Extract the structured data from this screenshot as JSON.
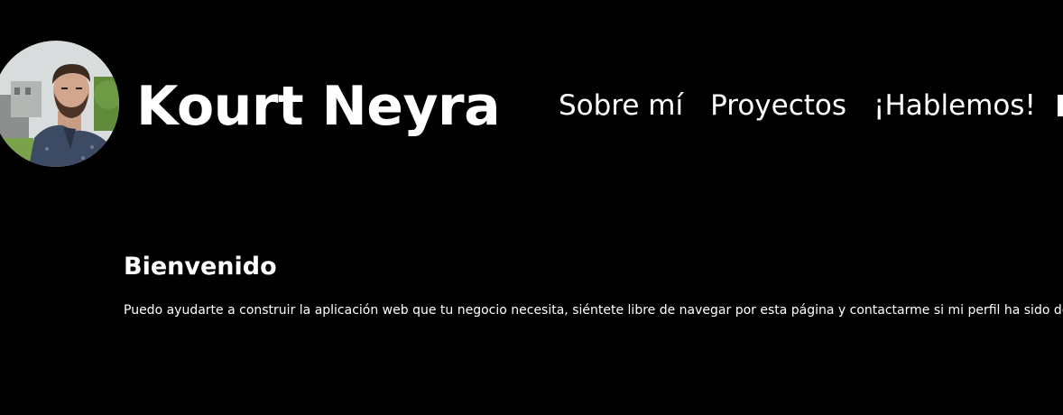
{
  "header": {
    "avatar_alt": "Kourt Neyra profile photo",
    "site_name": "Kourt Neyra",
    "nav": [
      {
        "label": "Sobre mí"
      },
      {
        "label": "Proyectos"
      },
      {
        "label": "¡Hablemos!"
      }
    ]
  },
  "main": {
    "welcome_title": "Bienvenido",
    "welcome_text": "Puedo ayudarte a construir la aplicación web que tu negocio necesita, siéntete libre de navegar por esta página y contactarme si mi perfil ha sido de"
  },
  "colors": {
    "background": "#000000",
    "text": "#ffffff"
  }
}
